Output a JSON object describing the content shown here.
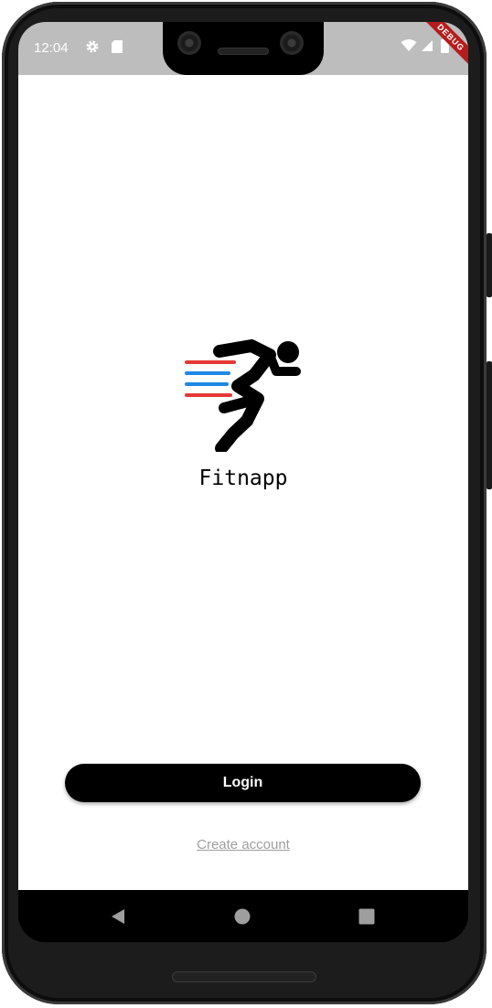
{
  "status_bar": {
    "time": "12:04",
    "debug_banner": "DEBUG"
  },
  "app": {
    "title": "Fitnapp"
  },
  "actions": {
    "login_label": "Login",
    "create_account_label": "Create account"
  },
  "colors": {
    "status_bar_bg": "#bdbdbd",
    "logo_red": "#e53935",
    "logo_blue": "#1e88e5",
    "button_bg": "#000000",
    "link_color": "#9e9e9e"
  }
}
